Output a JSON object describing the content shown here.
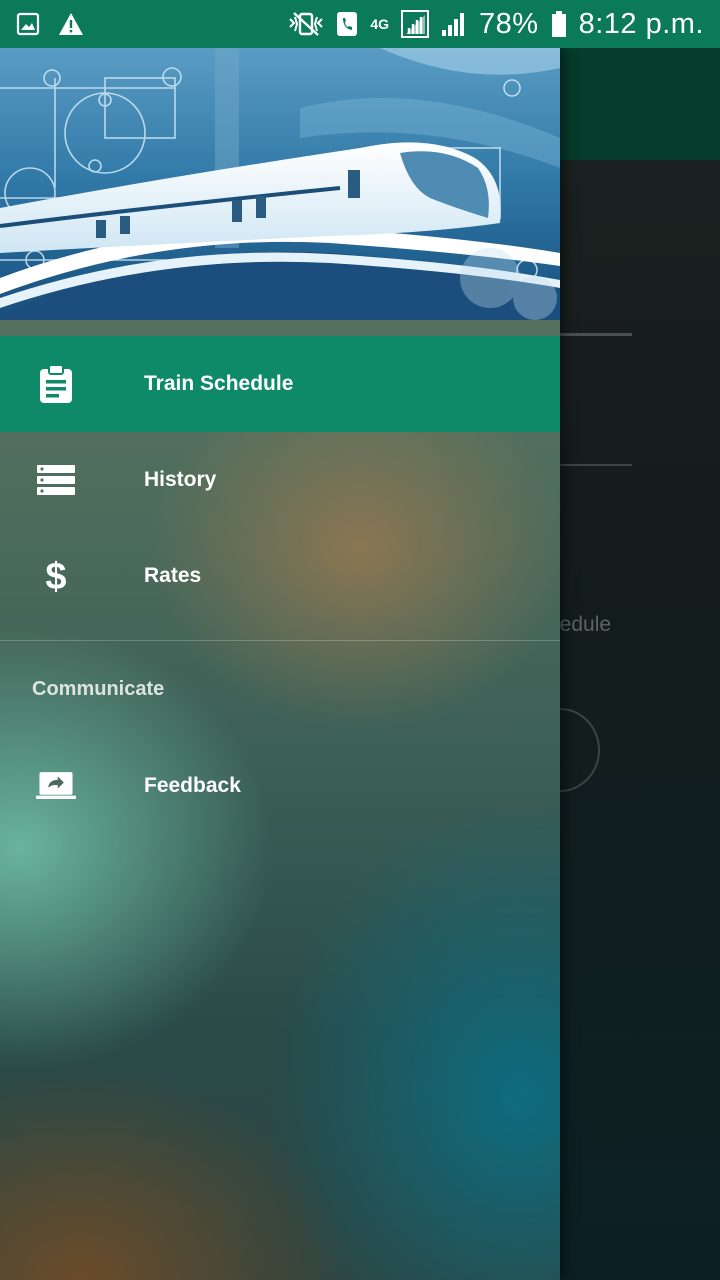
{
  "status_bar": {
    "battery_percent": "78%",
    "time": "8:12 p.m.",
    "network_label": "4G",
    "icons": [
      "gallery-icon",
      "warning-icon",
      "vibrate-icon",
      "call-icon",
      "lte-icon",
      "signal-icon",
      "signal-icon",
      "battery-icon"
    ]
  },
  "background_screen": {
    "partial_label": "hedule"
  },
  "drawer": {
    "header_image": "train-header-image",
    "items": [
      {
        "label": "Train Schedule",
        "icon": "clipboard-icon",
        "active": true
      },
      {
        "label": "History",
        "icon": "list-icon",
        "active": false
      },
      {
        "label": "Rates",
        "icon": "dollar-icon",
        "active": false
      }
    ],
    "section": {
      "title": "Communicate",
      "items": [
        {
          "label": "Feedback",
          "icon": "feedback-share-icon"
        }
      ]
    }
  },
  "colors": {
    "status_bar": "#0b7a58",
    "active_item": "#0e8a68",
    "toolbar": "#063c2c"
  }
}
